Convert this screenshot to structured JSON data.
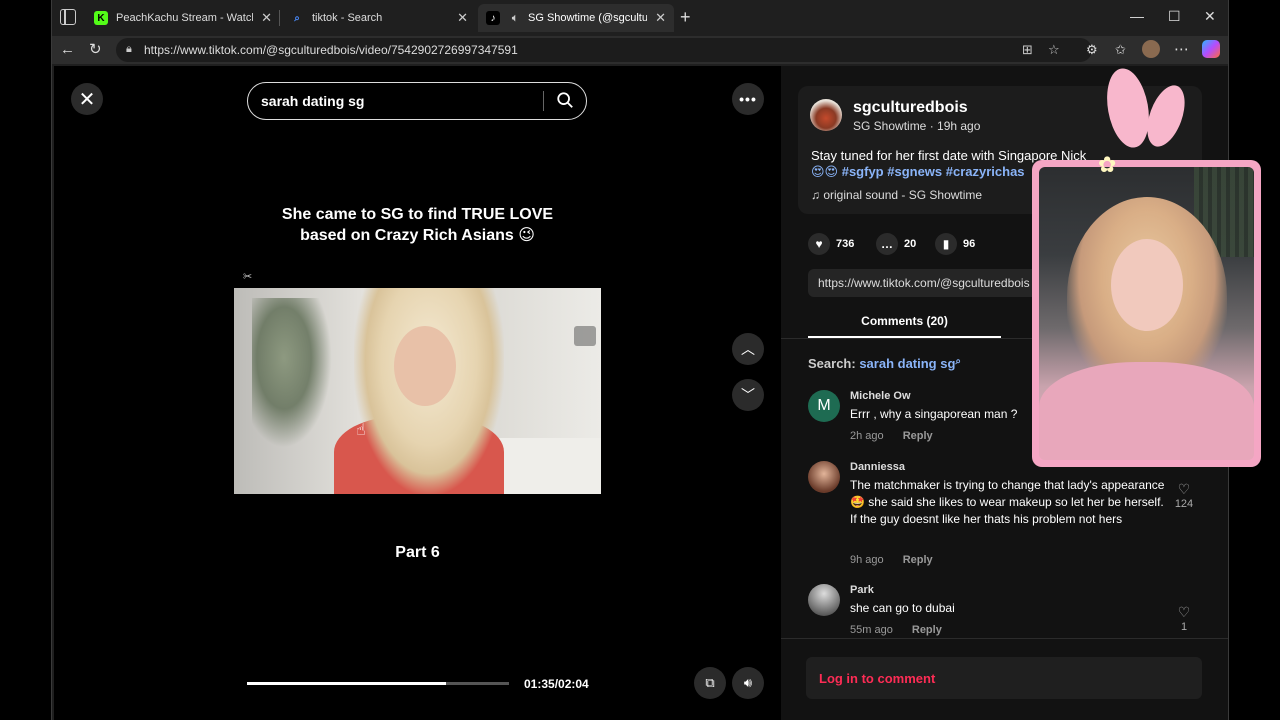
{
  "tabs": [
    {
      "title": "PeachKachu Stream - Watch Live",
      "favicon": "K"
    },
    {
      "title": "tiktok - Search",
      "favicon": "search"
    },
    {
      "title": "SG Showtime (@sgculturedb",
      "favicon": "tiktok"
    }
  ],
  "url": "https://www.tiktok.com/@sgculturedbois/video/7542902726997347591",
  "video": {
    "search_query": "sarah dating sg",
    "headline_line1": "She came to SG to find TRUE LOVE",
    "headline_line2": "based on Crazy Rich Asians 😉",
    "part_label": "Part 6",
    "current_time": "01:35/02:04",
    "progress": 0.76
  },
  "author": {
    "name": "sgculturedbois",
    "subtitle": "SG Showtime · 19h ago",
    "caption": "Stay tuned for her first date with Singapore Nick",
    "hashtags": "😍😍 #sgfyp #sgnews #crazyrichas",
    "sound": "original sound - SG Showtime"
  },
  "stats": {
    "likes": "736",
    "comments": "20",
    "saves": "96"
  },
  "link": "https://www.tiktok.com/@sgculturedbois",
  "comments_tab": "Comments (20)",
  "search_related": {
    "label": "Search:",
    "query": "sarah dating sg"
  },
  "comments": [
    {
      "name": "Michele Ow",
      "initial": "M",
      "text": "Errr , why a singaporean man ?",
      "time": "2h ago",
      "reply": "Reply",
      "likes": ""
    },
    {
      "name": "Danniessa",
      "initial": "",
      "text": "The matchmaker is trying to change that lady's appearance 🤩 she said she likes to wear makeup so let her be herself. If the guy doesnt like her thats his problem not hers",
      "time": "9h ago",
      "reply": "Reply",
      "likes": "124"
    },
    {
      "name": "Park",
      "initial": "",
      "text": "she can go to dubai",
      "time": "55m ago",
      "reply": "Reply",
      "likes": "1"
    }
  ],
  "login_label": "Log in to comment",
  "colors": {
    "accent": "#fe2c55",
    "link": "#8ab4f8",
    "overlay_border": "#f5a6c4"
  }
}
